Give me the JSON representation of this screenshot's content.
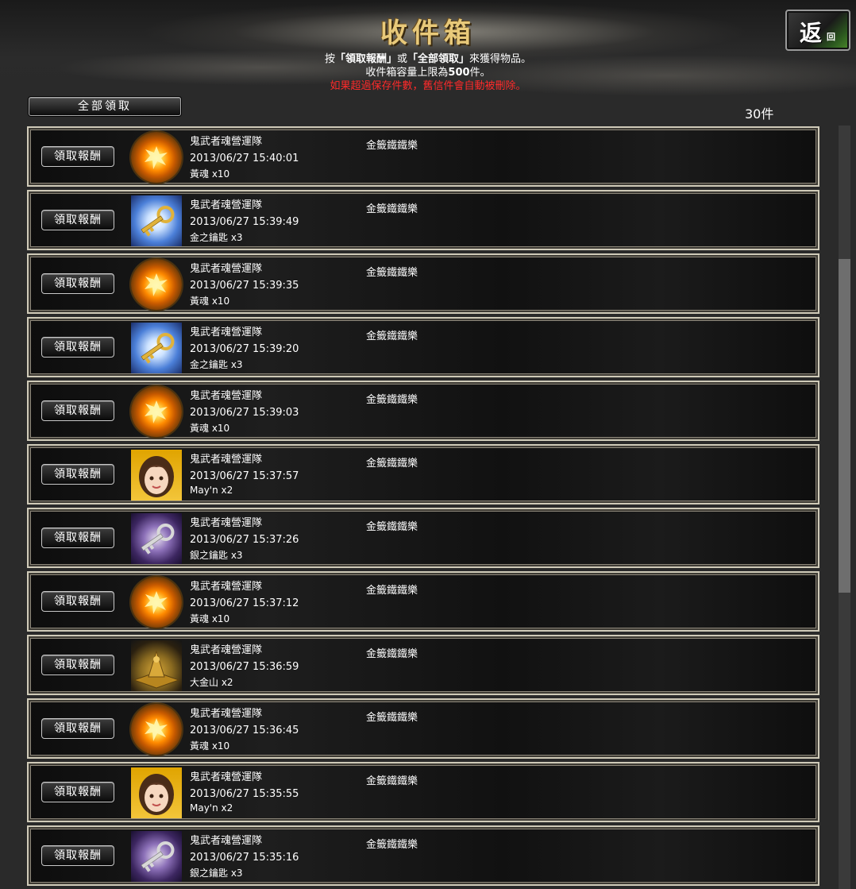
{
  "header": {
    "title": "收件箱",
    "back_label": "返",
    "back_sub": "回"
  },
  "instructions": {
    "line1_a": "按",
    "line1_b": "「領取報酬」",
    "line1_c": "或",
    "line1_d": "「全部領取」",
    "line1_e": "來獲得物品。",
    "line2_a": "收件箱容量上限為",
    "line2_b": "500",
    "line2_c": "件。",
    "line3": "如果超過保存件數，舊信件會自動被刪除。"
  },
  "toolbar": {
    "claim_all_label": "全部領取",
    "count": "30件"
  },
  "messages": [
    {
      "claim_label": "領取報酬",
      "icon": "soul-icon",
      "sender": "鬼武者魂營運隊",
      "date": "2013/06/27 15:40:01",
      "item": "黃魂 x10",
      "recipient": "金籤鐵鐵樂"
    },
    {
      "claim_label": "領取報酬",
      "icon": "gold-key-icon",
      "sender": "鬼武者魂營運隊",
      "date": "2013/06/27 15:39:49",
      "item": "金之鑰匙 x3",
      "recipient": "金籤鐵鐵樂"
    },
    {
      "claim_label": "領取報酬",
      "icon": "soul-icon",
      "sender": "鬼武者魂營運隊",
      "date": "2013/06/27 15:39:35",
      "item": "黃魂 x10",
      "recipient": "金籤鐵鐵樂"
    },
    {
      "claim_label": "領取報酬",
      "icon": "gold-key-icon",
      "sender": "鬼武者魂營運隊",
      "date": "2013/06/27 15:39:20",
      "item": "金之鑰匙 x3",
      "recipient": "金籤鐵鐵樂"
    },
    {
      "claim_label": "領取報酬",
      "icon": "soul-icon",
      "sender": "鬼武者魂營運隊",
      "date": "2013/06/27 15:39:03",
      "item": "黃魂 x10",
      "recipient": "金籤鐵鐵樂"
    },
    {
      "claim_label": "領取報酬",
      "icon": "mayn-portrait-icon",
      "sender": "鬼武者魂營運隊",
      "date": "2013/06/27 15:37:57",
      "item": "May'n x2",
      "recipient": "金籤鐵鐵樂"
    },
    {
      "claim_label": "領取報酬",
      "icon": "silver-key-icon",
      "sender": "鬼武者魂營運隊",
      "date": "2013/06/27 15:37:26",
      "item": "銀之鑰匙 x3",
      "recipient": "金籤鐵鐵樂"
    },
    {
      "claim_label": "領取報酬",
      "icon": "soul-icon",
      "sender": "鬼武者魂營運隊",
      "date": "2013/06/27 15:37:12",
      "item": "黃魂 x10",
      "recipient": "金籤鐵鐵樂"
    },
    {
      "claim_label": "領取報酬",
      "icon": "gold-mountain-icon",
      "sender": "鬼武者魂營運隊",
      "date": "2013/06/27 15:36:59",
      "item": "大金山 x2",
      "recipient": "金籤鐵鐵樂"
    },
    {
      "claim_label": "領取報酬",
      "icon": "soul-icon",
      "sender": "鬼武者魂營運隊",
      "date": "2013/06/27 15:36:45",
      "item": "黃魂 x10",
      "recipient": "金籤鐵鐵樂"
    },
    {
      "claim_label": "領取報酬",
      "icon": "mayn-portrait-icon",
      "sender": "鬼武者魂營運隊",
      "date": "2013/06/27 15:35:55",
      "item": "May'n x2",
      "recipient": "金籤鐵鐵樂"
    },
    {
      "claim_label": "領取報酬",
      "icon": "silver-key-icon",
      "sender": "鬼武者魂營運隊",
      "date": "2013/06/27 15:35:16",
      "item": "銀之鑰匙 x3",
      "recipient": "金籤鐵鐵樂"
    }
  ],
  "colors": {
    "title_gold": "#e8c97a",
    "warning_red": "#ff2a2a",
    "background": "#2a2a2a"
  }
}
